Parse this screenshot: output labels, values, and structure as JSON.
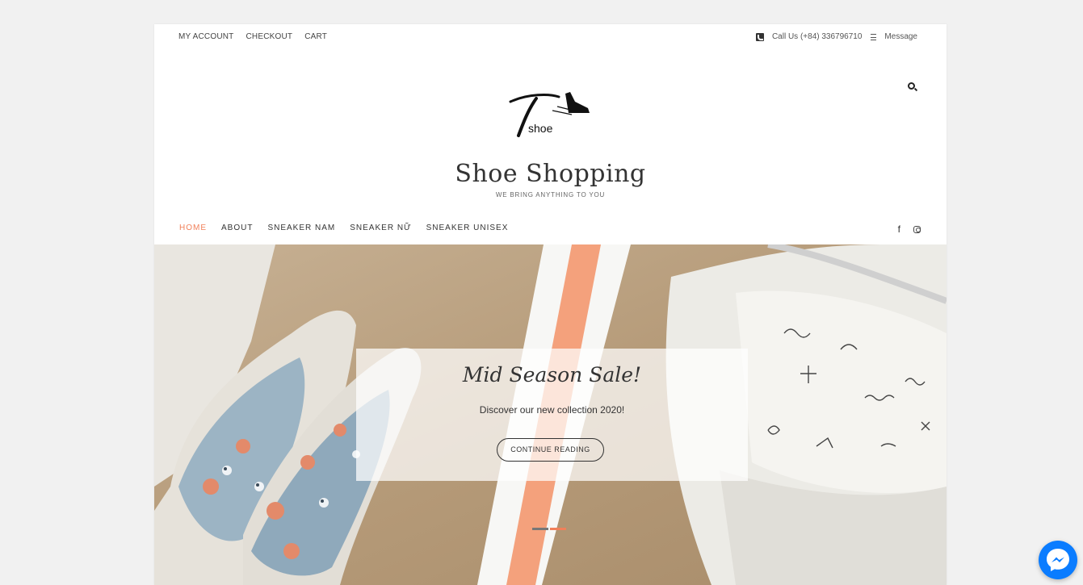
{
  "topbar": {
    "links": [
      "MY ACCOUNT",
      "CHECKOUT",
      "CART"
    ],
    "phone": "Call Us (+84) 336796710",
    "message": "Message"
  },
  "site": {
    "logo_text": "shoe",
    "title": "Shoe Shopping",
    "tagline": "WE BRING ANYTHING TO YOU"
  },
  "nav": {
    "items": [
      "HOME",
      "ABOUT",
      "SNEAKER NAM",
      "SNEAKER NỮ",
      "SNEAKER UNISEX"
    ],
    "active_index": 0
  },
  "social": {
    "facebook": "f"
  },
  "hero": {
    "title": "Mid Season Sale!",
    "subtitle": "Discover our new collection 2020!",
    "button": "CONTINUE READING",
    "dots_count": 2,
    "active_dot": 1
  },
  "colors": {
    "accent": "#f1805a",
    "background": "#f1f1f1",
    "messenger": "#0a7cff"
  },
  "icons": [
    "phone-icon",
    "message-icon",
    "search-icon",
    "facebook-icon",
    "instagram-icon",
    "messenger-icon"
  ]
}
